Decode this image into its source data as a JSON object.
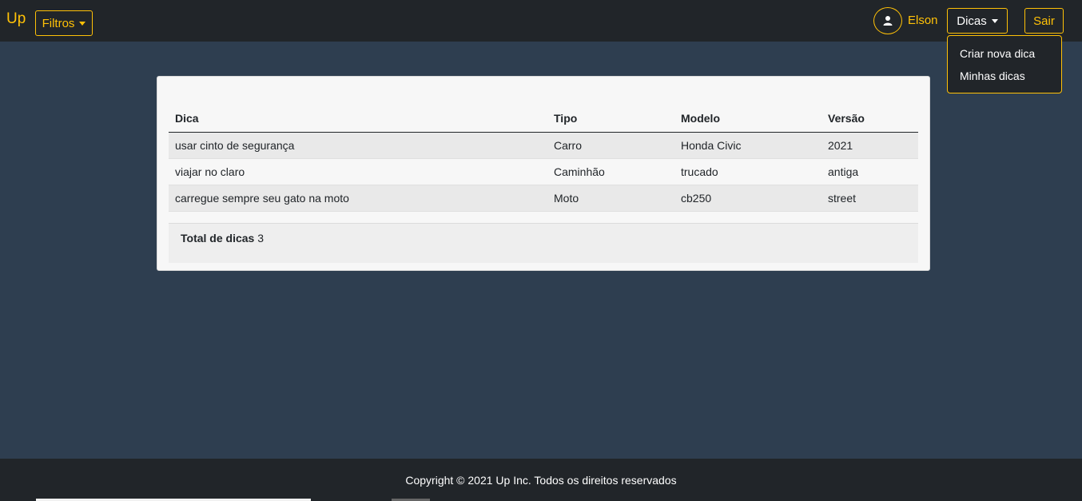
{
  "navbar": {
    "brand": "Up",
    "filtros_label": "Filtros",
    "user_name": "Elson",
    "dicas_label": "Dicas",
    "sair_label": "Sair",
    "dicas_menu": [
      "Criar nova dica",
      "Minhas dicas"
    ]
  },
  "table": {
    "headers": [
      "Dica",
      "Tipo",
      "Modelo",
      "Versão"
    ],
    "rows": [
      [
        "usar cinto de segurança",
        "Carro",
        "Honda Civic",
        "2021"
      ],
      [
        "viajar no claro",
        "Caminhão",
        "trucado",
        "antiga"
      ],
      [
        "carregue sempre seu gato na moto",
        "Moto",
        "cb250",
        "street"
      ]
    ]
  },
  "total": {
    "label": "Total de dicas",
    "value": "3"
  },
  "footer": {
    "text": "Copyright © 2021 Up Inc. Todos os direitos reservados"
  },
  "colors": {
    "accent": "#ffc107",
    "navbar_bg": "#212529",
    "page_bg": "#2e3e50"
  },
  "icons": {
    "avatar": "user-icon",
    "dropdown": "caret-down-icon"
  }
}
